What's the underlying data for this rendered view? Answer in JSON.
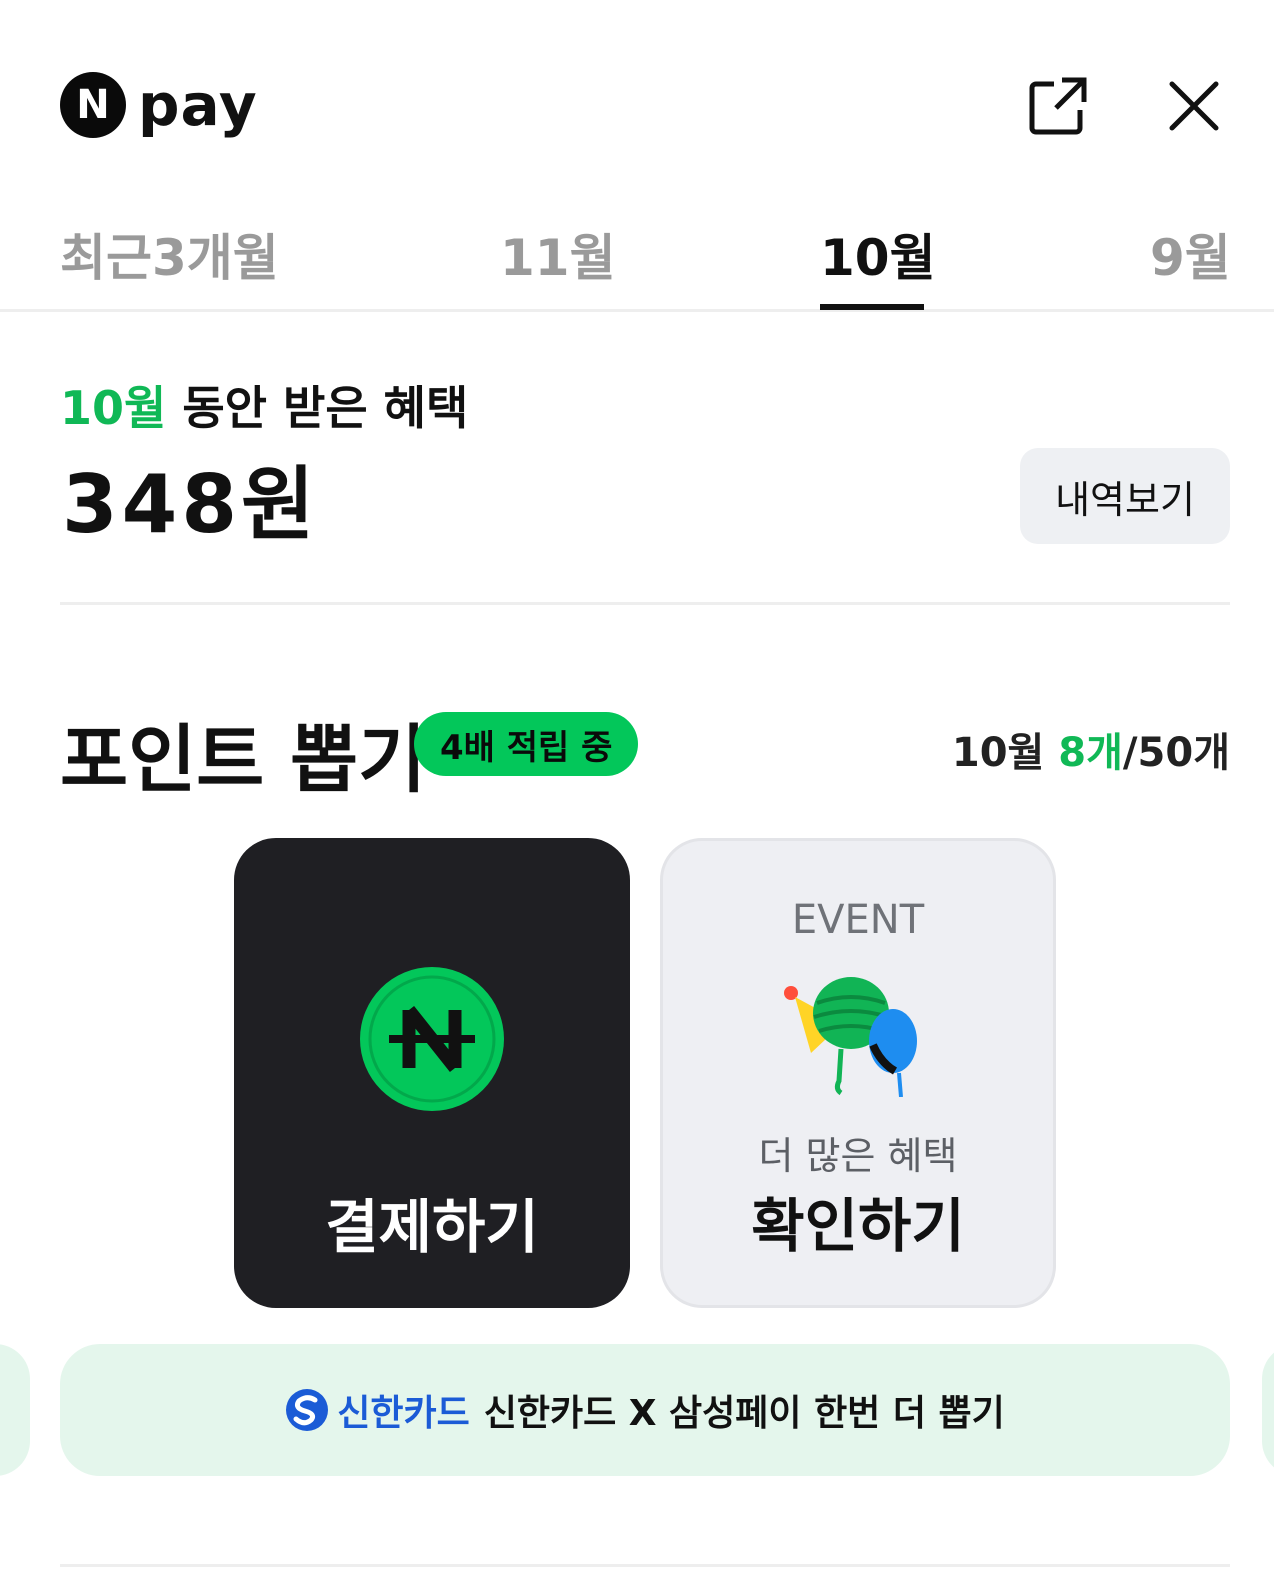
{
  "header": {
    "logo_badge": "N",
    "logo_text": "pay",
    "share_icon": "share-external-icon",
    "close_icon": "close-icon"
  },
  "tabs": [
    {
      "label": "최근3개월",
      "active": false
    },
    {
      "label": "11월",
      "active": false
    },
    {
      "label": "10월",
      "active": true
    },
    {
      "label": "9월",
      "active": false
    }
  ],
  "benefit": {
    "month": "10월",
    "title_suffix": " 동안 받은 혜택",
    "amount": "348원",
    "history_button": "내역보기"
  },
  "point_draw": {
    "title": "포인트 뽑기",
    "badge": "4배 적립 중",
    "count_month": "10월 ",
    "count_used": "8개",
    "count_total": "/50개",
    "accent_color": "#03c75a"
  },
  "cards": {
    "pay": {
      "label": "결제하기",
      "icon": "npay-coin-icon"
    },
    "event": {
      "tag": "EVENT",
      "subtitle": "더 많은 혜택",
      "label": "확인하기",
      "icon": "party-balloons-icon"
    }
  },
  "banner": {
    "brand": "신한카드",
    "text": "신한카드 X 삼성페이 한번 더 뽑기",
    "brand_color": "#1b5bd6"
  }
}
